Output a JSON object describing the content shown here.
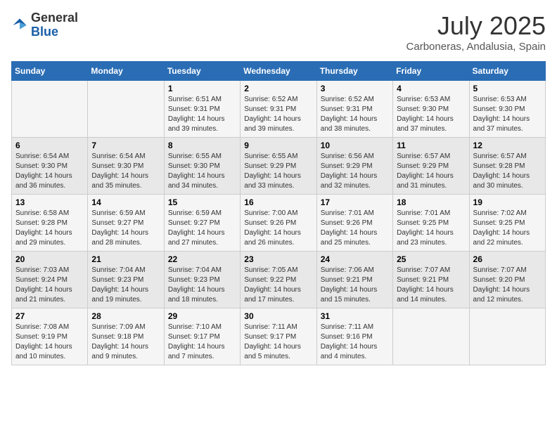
{
  "header": {
    "logo_general": "General",
    "logo_blue": "Blue",
    "month_year": "July 2025",
    "location": "Carboneras, Andalusia, Spain"
  },
  "weekdays": [
    "Sunday",
    "Monday",
    "Tuesday",
    "Wednesday",
    "Thursday",
    "Friday",
    "Saturday"
  ],
  "weeks": [
    [
      {
        "day": "",
        "sunrise": "",
        "sunset": "",
        "daylight": ""
      },
      {
        "day": "",
        "sunrise": "",
        "sunset": "",
        "daylight": ""
      },
      {
        "day": "1",
        "sunrise": "Sunrise: 6:51 AM",
        "sunset": "Sunset: 9:31 PM",
        "daylight": "Daylight: 14 hours and 39 minutes."
      },
      {
        "day": "2",
        "sunrise": "Sunrise: 6:52 AM",
        "sunset": "Sunset: 9:31 PM",
        "daylight": "Daylight: 14 hours and 39 minutes."
      },
      {
        "day": "3",
        "sunrise": "Sunrise: 6:52 AM",
        "sunset": "Sunset: 9:31 PM",
        "daylight": "Daylight: 14 hours and 38 minutes."
      },
      {
        "day": "4",
        "sunrise": "Sunrise: 6:53 AM",
        "sunset": "Sunset: 9:30 PM",
        "daylight": "Daylight: 14 hours and 37 minutes."
      },
      {
        "day": "5",
        "sunrise": "Sunrise: 6:53 AM",
        "sunset": "Sunset: 9:30 PM",
        "daylight": "Daylight: 14 hours and 37 minutes."
      }
    ],
    [
      {
        "day": "6",
        "sunrise": "Sunrise: 6:54 AM",
        "sunset": "Sunset: 9:30 PM",
        "daylight": "Daylight: 14 hours and 36 minutes."
      },
      {
        "day": "7",
        "sunrise": "Sunrise: 6:54 AM",
        "sunset": "Sunset: 9:30 PM",
        "daylight": "Daylight: 14 hours and 35 minutes."
      },
      {
        "day": "8",
        "sunrise": "Sunrise: 6:55 AM",
        "sunset": "Sunset: 9:30 PM",
        "daylight": "Daylight: 14 hours and 34 minutes."
      },
      {
        "day": "9",
        "sunrise": "Sunrise: 6:55 AM",
        "sunset": "Sunset: 9:29 PM",
        "daylight": "Daylight: 14 hours and 33 minutes."
      },
      {
        "day": "10",
        "sunrise": "Sunrise: 6:56 AM",
        "sunset": "Sunset: 9:29 PM",
        "daylight": "Daylight: 14 hours and 32 minutes."
      },
      {
        "day": "11",
        "sunrise": "Sunrise: 6:57 AM",
        "sunset": "Sunset: 9:29 PM",
        "daylight": "Daylight: 14 hours and 31 minutes."
      },
      {
        "day": "12",
        "sunrise": "Sunrise: 6:57 AM",
        "sunset": "Sunset: 9:28 PM",
        "daylight": "Daylight: 14 hours and 30 minutes."
      }
    ],
    [
      {
        "day": "13",
        "sunrise": "Sunrise: 6:58 AM",
        "sunset": "Sunset: 9:28 PM",
        "daylight": "Daylight: 14 hours and 29 minutes."
      },
      {
        "day": "14",
        "sunrise": "Sunrise: 6:59 AM",
        "sunset": "Sunset: 9:27 PM",
        "daylight": "Daylight: 14 hours and 28 minutes."
      },
      {
        "day": "15",
        "sunrise": "Sunrise: 6:59 AM",
        "sunset": "Sunset: 9:27 PM",
        "daylight": "Daylight: 14 hours and 27 minutes."
      },
      {
        "day": "16",
        "sunrise": "Sunrise: 7:00 AM",
        "sunset": "Sunset: 9:26 PM",
        "daylight": "Daylight: 14 hours and 26 minutes."
      },
      {
        "day": "17",
        "sunrise": "Sunrise: 7:01 AM",
        "sunset": "Sunset: 9:26 PM",
        "daylight": "Daylight: 14 hours and 25 minutes."
      },
      {
        "day": "18",
        "sunrise": "Sunrise: 7:01 AM",
        "sunset": "Sunset: 9:25 PM",
        "daylight": "Daylight: 14 hours and 23 minutes."
      },
      {
        "day": "19",
        "sunrise": "Sunrise: 7:02 AM",
        "sunset": "Sunset: 9:25 PM",
        "daylight": "Daylight: 14 hours and 22 minutes."
      }
    ],
    [
      {
        "day": "20",
        "sunrise": "Sunrise: 7:03 AM",
        "sunset": "Sunset: 9:24 PM",
        "daylight": "Daylight: 14 hours and 21 minutes."
      },
      {
        "day": "21",
        "sunrise": "Sunrise: 7:04 AM",
        "sunset": "Sunset: 9:23 PM",
        "daylight": "Daylight: 14 hours and 19 minutes."
      },
      {
        "day": "22",
        "sunrise": "Sunrise: 7:04 AM",
        "sunset": "Sunset: 9:23 PM",
        "daylight": "Daylight: 14 hours and 18 minutes."
      },
      {
        "day": "23",
        "sunrise": "Sunrise: 7:05 AM",
        "sunset": "Sunset: 9:22 PM",
        "daylight": "Daylight: 14 hours and 17 minutes."
      },
      {
        "day": "24",
        "sunrise": "Sunrise: 7:06 AM",
        "sunset": "Sunset: 9:21 PM",
        "daylight": "Daylight: 14 hours and 15 minutes."
      },
      {
        "day": "25",
        "sunrise": "Sunrise: 7:07 AM",
        "sunset": "Sunset: 9:21 PM",
        "daylight": "Daylight: 14 hours and 14 minutes."
      },
      {
        "day": "26",
        "sunrise": "Sunrise: 7:07 AM",
        "sunset": "Sunset: 9:20 PM",
        "daylight": "Daylight: 14 hours and 12 minutes."
      }
    ],
    [
      {
        "day": "27",
        "sunrise": "Sunrise: 7:08 AM",
        "sunset": "Sunset: 9:19 PM",
        "daylight": "Daylight: 14 hours and 10 minutes."
      },
      {
        "day": "28",
        "sunrise": "Sunrise: 7:09 AM",
        "sunset": "Sunset: 9:18 PM",
        "daylight": "Daylight: 14 hours and 9 minutes."
      },
      {
        "day": "29",
        "sunrise": "Sunrise: 7:10 AM",
        "sunset": "Sunset: 9:17 PM",
        "daylight": "Daylight: 14 hours and 7 minutes."
      },
      {
        "day": "30",
        "sunrise": "Sunrise: 7:11 AM",
        "sunset": "Sunset: 9:17 PM",
        "daylight": "Daylight: 14 hours and 5 minutes."
      },
      {
        "day": "31",
        "sunrise": "Sunrise: 7:11 AM",
        "sunset": "Sunset: 9:16 PM",
        "daylight": "Daylight: 14 hours and 4 minutes."
      },
      {
        "day": "",
        "sunrise": "",
        "sunset": "",
        "daylight": ""
      },
      {
        "day": "",
        "sunrise": "",
        "sunset": "",
        "daylight": ""
      }
    ]
  ]
}
